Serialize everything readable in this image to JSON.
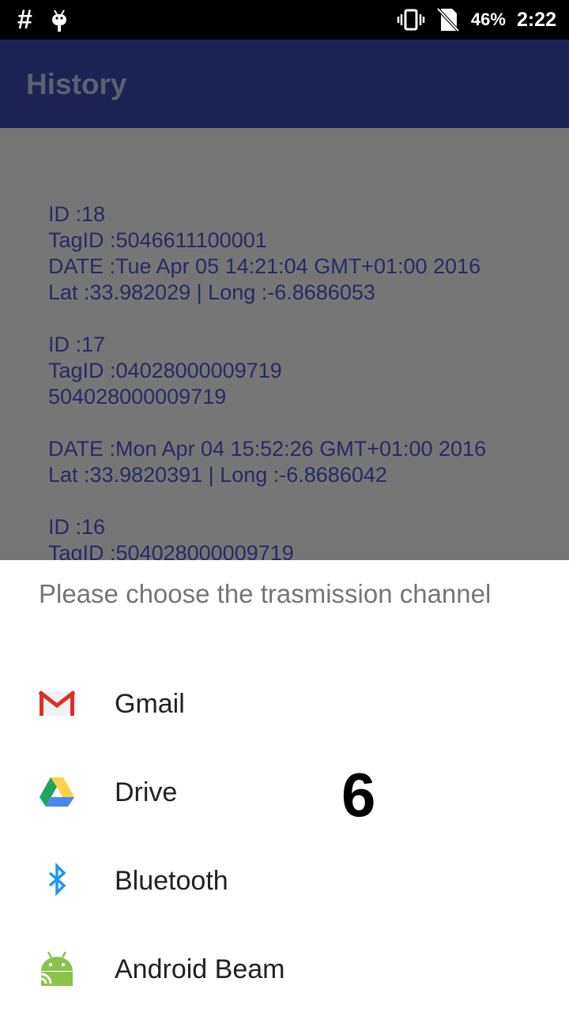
{
  "status_bar": {
    "left_symbol": "#",
    "left_icons": [
      "hash-icon",
      "android-debug-icon"
    ],
    "right_icons": [
      "vibrate-icon",
      "no-sim-icon"
    ],
    "battery": "46%",
    "time": "2:22"
  },
  "app_bar": {
    "title": "History"
  },
  "history": {
    "entries": [
      {
        "lines": [
          "ID :18",
          "TagID :5046611100001",
          "DATE :Tue Apr 05 14:21:04 GMT+01:00 2016",
          "Lat :33.982029 | Long :-6.8686053"
        ]
      },
      {
        "lines": [
          "ID :17",
          "TagID :04028000009719",
          "504028000009719",
          "",
          "DATE :Mon Apr 04 15:52:26 GMT+01:00 2016",
          "Lat :33.9820391 | Long :-6.8686042"
        ]
      },
      {
        "lines": [
          "ID :16",
          "TagID :504028000009719"
        ]
      }
    ]
  },
  "chooser": {
    "title": "Please choose the trasmission channel",
    "options": [
      {
        "label": "Gmail",
        "icon": "gmail-icon"
      },
      {
        "label": "Drive",
        "icon": "drive-icon"
      },
      {
        "label": "Bluetooth",
        "icon": "bluetooth-icon"
      },
      {
        "label": "Android Beam",
        "icon": "android-beam-icon"
      }
    ]
  },
  "overlay_label": "6",
  "colors": {
    "app_bar": "#1c2254",
    "dim_background": "#767676",
    "history_text": "#262b64",
    "gmail_red": "#d93025",
    "drive_green": "#1fa463",
    "drive_yellow": "#ffd04b",
    "drive_blue": "#4688f4",
    "bluetooth_blue": "#2196f3",
    "android_green": "#8bc34a"
  }
}
